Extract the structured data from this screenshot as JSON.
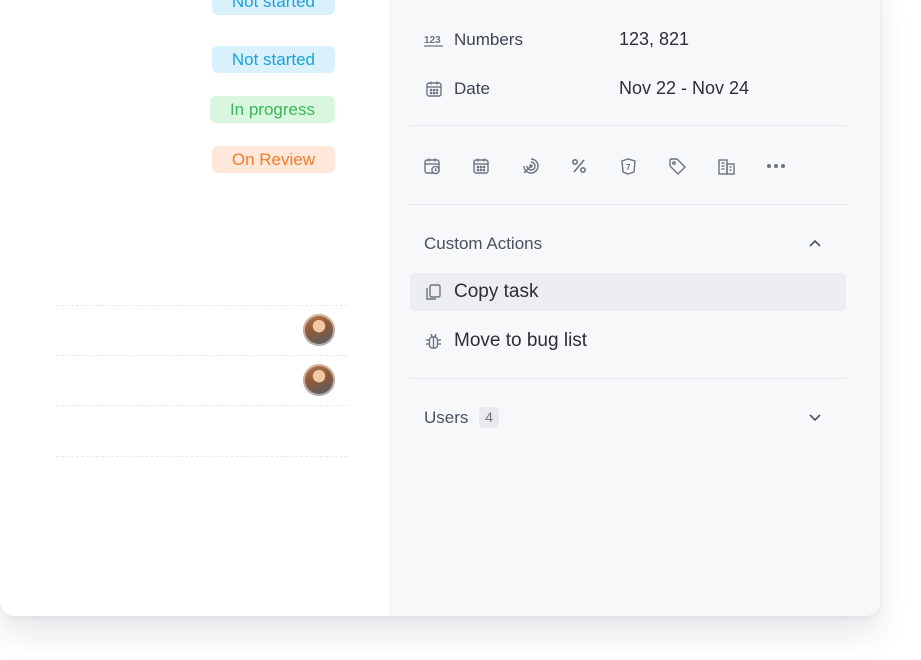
{
  "statuses": [
    {
      "label": "Not started",
      "color": "#1aa3da"
    },
    {
      "label": "Not started",
      "color": "#1aa3da"
    },
    {
      "label": "In progress",
      "color": "#3cb65a"
    },
    {
      "label": "On Review",
      "color": "#f47c2c"
    }
  ],
  "properties": {
    "numbers": {
      "label": "Numbers",
      "value": "123, 821",
      "icon": "numbers-icon"
    },
    "date": {
      "label": "Date",
      "value": "Nov  22 - Nov 24",
      "icon": "calendar-icon"
    }
  },
  "toolbar_icons": [
    "calendar-clock-icon",
    "calendar-icon",
    "radar-icon",
    "percent-icon",
    "card-icon",
    "tag-icon",
    "building-icon",
    "more-icon"
  ],
  "custom_actions": {
    "title": "Custom Actions",
    "items": [
      {
        "label": "Copy task",
        "icon": "copy-icon"
      },
      {
        "label": "Move to bug list",
        "icon": "bug-icon"
      }
    ]
  },
  "users": {
    "title": "Users",
    "count": "4"
  }
}
